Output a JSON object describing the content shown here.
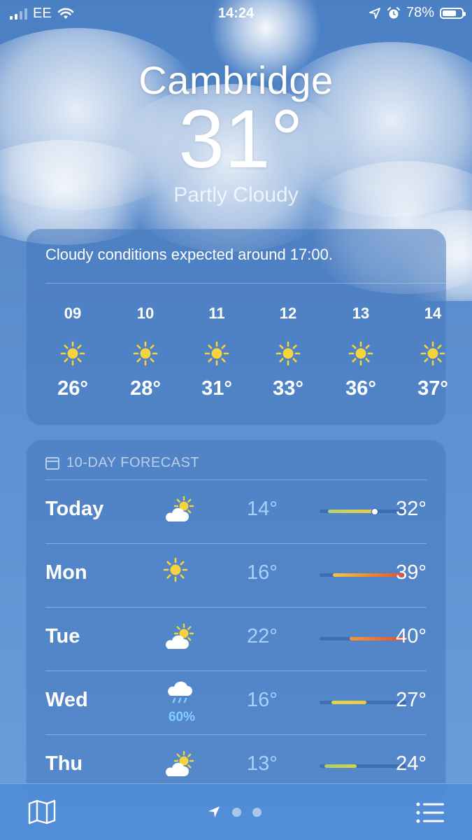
{
  "status_bar": {
    "carrier": "EE",
    "time": "14:24",
    "battery_percent": "78%",
    "battery_level": 0.78,
    "icons": [
      "signal-icon",
      "wifi-icon",
      "location-arrow-icon",
      "alarm-icon",
      "battery-icon"
    ]
  },
  "header": {
    "city": "Cambridge",
    "temperature": "31°",
    "condition": "Partly Cloudy"
  },
  "hourly": {
    "summary": "Cloudy conditions expected around 17:00.",
    "hours": [
      {
        "hour": "09",
        "icon": "sun-icon",
        "temp": "26°"
      },
      {
        "hour": "10",
        "icon": "sun-icon",
        "temp": "28°"
      },
      {
        "hour": "11",
        "icon": "sun-icon",
        "temp": "31°"
      },
      {
        "hour": "12",
        "icon": "sun-icon",
        "temp": "33°"
      },
      {
        "hour": "13",
        "icon": "sun-icon",
        "temp": "36°"
      },
      {
        "hour": "14",
        "icon": "sun-icon",
        "temp": "37°"
      }
    ]
  },
  "forecast": {
    "title": "10-DAY FORECAST",
    "days": [
      {
        "day": "Today",
        "icon": "partly-cloudy-icon",
        "precip": "",
        "low": "14°",
        "high": "32°",
        "range_start": 0.1,
        "range_end": 0.65,
        "current": 0.64,
        "colors": [
          "#b6d36a",
          "#f2c84a"
        ]
      },
      {
        "day": "Mon",
        "icon": "sun-icon",
        "precip": "",
        "low": "16°",
        "high": "39°",
        "range_start": 0.15,
        "range_end": 1.0,
        "colors": [
          "#f3c843",
          "#f0872e",
          "#e64a3a"
        ]
      },
      {
        "day": "Tue",
        "icon": "partly-cloudy-icon",
        "precip": "",
        "low": "22°",
        "high": "40°",
        "range_start": 0.35,
        "range_end": 1.0,
        "colors": [
          "#f19a33",
          "#e34a3c"
        ]
      },
      {
        "day": "Wed",
        "icon": "rain-cloud-icon",
        "precip": "60%",
        "low": "16°",
        "high": "27°",
        "range_start": 0.14,
        "range_end": 0.54,
        "colors": [
          "#d8d84a",
          "#f2c84a"
        ]
      },
      {
        "day": "Thu",
        "icon": "partly-cloudy-icon",
        "precip": "",
        "low": "13°",
        "high": "24°",
        "range_start": 0.06,
        "range_end": 0.43,
        "colors": [
          "#a8d070",
          "#d6d24a"
        ]
      }
    ]
  },
  "colors": {
    "sun": "#f6d33c",
    "precip": "#7fd0ff"
  }
}
